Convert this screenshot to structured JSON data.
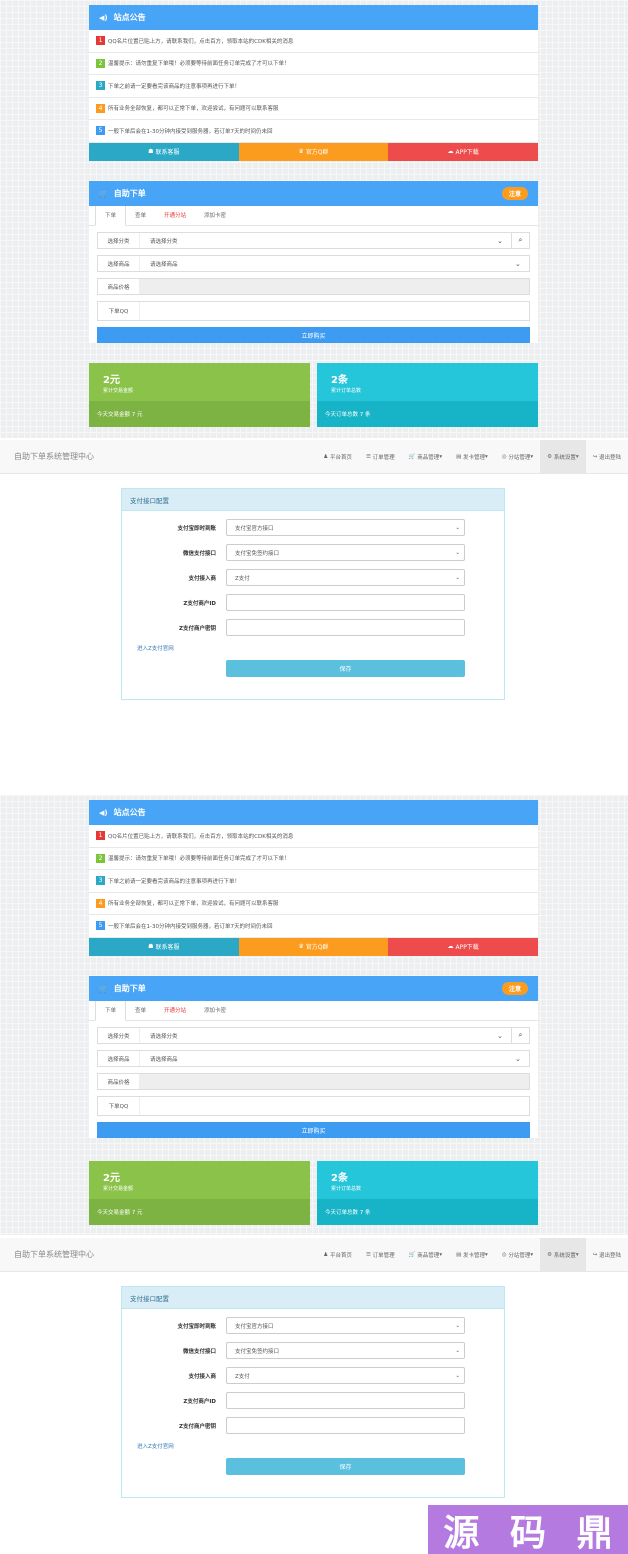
{
  "announcement": {
    "title": "站点公告",
    "items": [
      {
        "n": "1",
        "color": "#e53935",
        "text": "QQ名片位置已贴上方，请联系我们，点击百方，领取本站的CDK相关的消息"
      },
      {
        "n": "2",
        "color": "#7cc53b",
        "text": "温馨提示：请勿重复下单哦！必须要等待前面任务订单完成了才可以下单！"
      },
      {
        "n": "3",
        "color": "#2aa8c6",
        "text": "下单之前请一定要看完该商品的注意事项再进行下单！"
      },
      {
        "n": "4",
        "color": "#fb9c1e",
        "text": "所有业务全部恢复，都可以正常下单，欢迎尝试，有问题可以联系客服"
      },
      {
        "n": "5",
        "color": "#3d9cf2",
        "text": "一般下单后会在1-30分钟内接受到服务器，若订单7天的时间仍未回"
      }
    ],
    "buttons": [
      {
        "label": "联系客服",
        "color": "#2aa8c6"
      },
      {
        "label": "官方Q群",
        "color": "#fb9c1e"
      },
      {
        "label": "APP下载",
        "color": "#ee4c4c"
      }
    ]
  },
  "order": {
    "title": "自助下单",
    "pill": "注意",
    "tabs": [
      "下单",
      "查单",
      "开通分站",
      "添加卡密"
    ],
    "category_label": "选择分类",
    "category_value": "请选择分类",
    "product_label": "选择商品",
    "product_value": "请选择商品",
    "price_label": "商品价格",
    "qq_label": "下单QQ",
    "buy_label": "立即购买"
  },
  "stats": [
    {
      "big": "2元",
      "sub": "累计交易金额",
      "bottom": "今天交易金额 7 元",
      "top_color": "#8bc34a",
      "bot_color": "#7cb342"
    },
    {
      "big": "2条",
      "sub": "累计订单总数",
      "bottom": "今天订单总数 7 条",
      "top_color": "#26c6da",
      "bot_color": "#17b3c7"
    }
  ],
  "admin": {
    "brand": "自助下单系统管理中心",
    "nav": [
      "平台首页",
      "订单管理",
      "商品管理",
      "发卡管理",
      "分站管理",
      "系统设置",
      "退出登陆"
    ],
    "panel_title": "支付接口配置",
    "fields": [
      {
        "label": "支付宝即时到账",
        "value": "支付宝官方接口"
      },
      {
        "label": "微信支付接口",
        "value": "支付宝免签约接口"
      },
      {
        "label": "支付接入商",
        "value": "Z支付"
      }
    ],
    "inputs": [
      {
        "label": "Z支付商户ID"
      },
      {
        "label": "Z支付商户密钥"
      }
    ],
    "link": "进入Z支付官网",
    "save": "保存"
  },
  "watermark": [
    "源",
    "码",
    "鼎"
  ]
}
